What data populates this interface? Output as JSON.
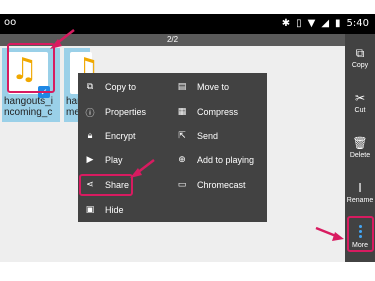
{
  "status_bar": {
    "voicemail_icon": "voicemail-icon",
    "bluetooth_icon": "bluetooth-icon",
    "vibrate_icon": "vibrate-icon",
    "wifi_icon": "wifi-icon",
    "signal_icon": "signal-icon",
    "battery_icon": "battery-icon",
    "time": "5:40"
  },
  "page_indicator": "2/2",
  "files": [
    {
      "name": "hangouts_incoming_c",
      "name_display": "hangouts_i\nncoming_c",
      "icon": "music-file-icon",
      "selected": true
    },
    {
      "name": "hangouts_message",
      "name_display": "han\nme",
      "icon": "music-file-icon",
      "selected": false
    }
  ],
  "menu": {
    "items": [
      {
        "label": "Copy to",
        "icon": "copy-to-icon"
      },
      {
        "label": "Move to",
        "icon": "move-to-icon"
      },
      {
        "label": "Properties",
        "icon": "info-icon"
      },
      {
        "label": "Compress",
        "icon": "compress-icon"
      },
      {
        "label": "Encrypt",
        "icon": "lock-icon"
      },
      {
        "label": "Send",
        "icon": "send-icon"
      },
      {
        "label": "Play",
        "icon": "play-icon"
      },
      {
        "label": "Add to playing",
        "icon": "add-to-playing-icon"
      },
      {
        "label": "Share",
        "icon": "share-icon"
      },
      {
        "label": "Chromecast",
        "icon": "chromecast-icon"
      },
      {
        "label": "Hide",
        "icon": "hide-icon"
      }
    ]
  },
  "rail": {
    "copy_label": "Copy",
    "cut_label": "Cut",
    "delete_label": "Delete",
    "rename_label": "Rename",
    "more_label": "More"
  },
  "colors": {
    "highlight": "#d81b60",
    "selection": "#9ad0e8",
    "menu_bg": "#424242",
    "accent": "#42a5f5"
  }
}
